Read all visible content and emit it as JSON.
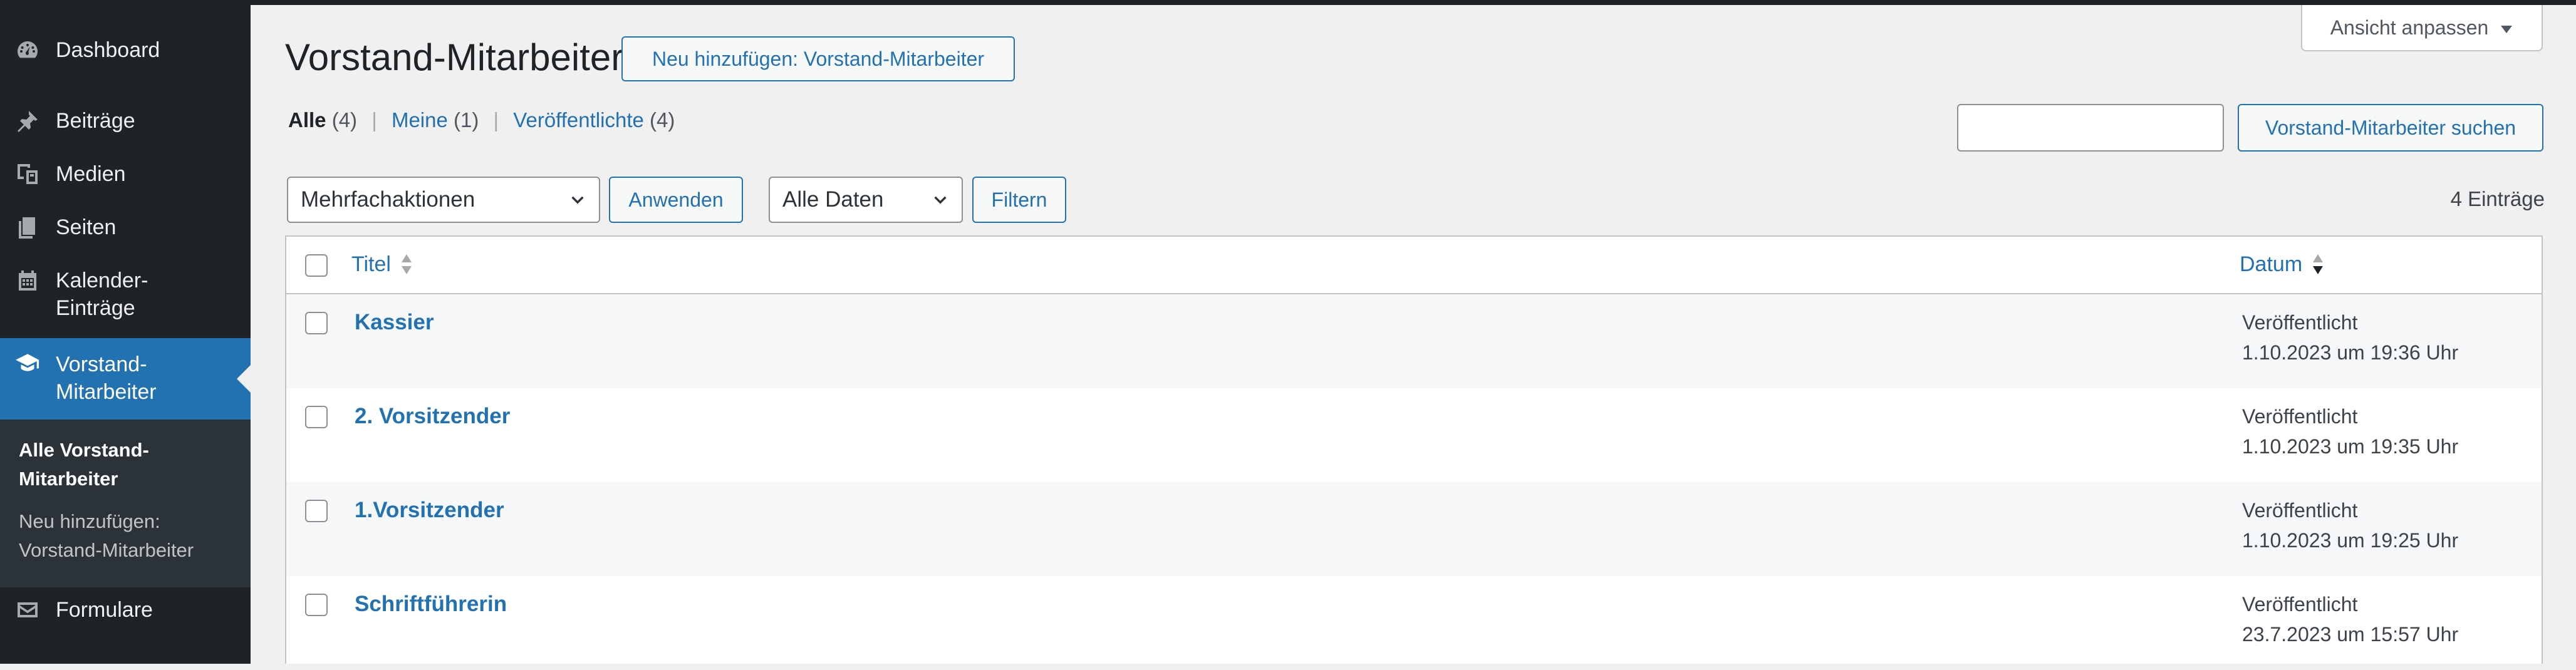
{
  "sidebar": {
    "items": [
      {
        "label": "Dashboard",
        "icon": "dashboard-icon"
      },
      {
        "label": "Beiträge",
        "icon": "pin-icon"
      },
      {
        "label": "Medien",
        "icon": "media-icon"
      },
      {
        "label": "Seiten",
        "icon": "pages-icon"
      },
      {
        "label": "Kalender-",
        "label2": "Einträge",
        "icon": "calendar-icon"
      },
      {
        "label": "Vorstand-",
        "label2": "Mitarbeiter",
        "icon": "graduation-cap-icon"
      },
      {
        "label": "Formulare",
        "icon": "envelope-icon"
      }
    ],
    "submenu": {
      "all_line1": "Alle Vorstand-",
      "all_line2": "Mitarbeiter",
      "add_line1": "Neu hinzufügen:",
      "add_line2": "Vorstand-Mitarbeiter"
    }
  },
  "header": {
    "title": "Vorstand-Mitarbeiter",
    "add_new_label": "Neu hinzufügen: Vorstand-Mitarbeiter",
    "screen_options_label": "Ansicht anpassen"
  },
  "views": {
    "all_label": "Alle",
    "all_count": "(4)",
    "mine_label": "Meine",
    "mine_count": "(1)",
    "published_label": "Veröffentlichte",
    "published_count": "(4)",
    "separator": "|"
  },
  "search": {
    "value": "",
    "button_label": "Vorstand-Mitarbeiter suchen"
  },
  "tablenav": {
    "bulk_actions": "Mehrfachaktionen",
    "apply_label": "Anwenden",
    "dates_filter": "Alle Daten",
    "filter_label": "Filtern",
    "items_count": "4 Einträge"
  },
  "table": {
    "col_title": "Titel",
    "col_date": "Datum",
    "rows": [
      {
        "title": "Kassier",
        "status": "Veröffentlicht",
        "datetime": "1.10.2023 um 19:36 Uhr"
      },
      {
        "title": "2. Vorsitzender",
        "status": "Veröffentlicht",
        "datetime": "1.10.2023 um 19:35 Uhr"
      },
      {
        "title": "1.Vorsitzender",
        "status": "Veröffentlicht",
        "datetime": "1.10.2023 um 19:25 Uhr"
      },
      {
        "title": "Schriftführerin",
        "status": "Veröffentlicht",
        "datetime": "23.7.2023 um 15:57 Uhr"
      }
    ]
  },
  "colors": {
    "sidebar_bg": "#1d2327",
    "accent": "#2271b1",
    "page_bg": "#f0f0f1"
  }
}
